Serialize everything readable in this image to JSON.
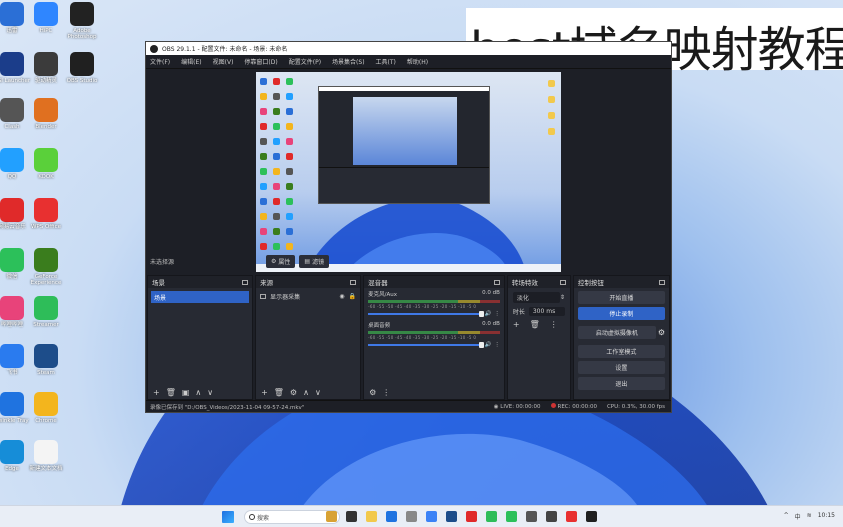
{
  "banner": {
    "text": "host域名映射教程"
  },
  "desktop": {
    "icons": [
      {
        "label": "迅雷",
        "color": "#2b6fd6"
      },
      {
        "label": "HiPC",
        "color": "#2f86ff"
      },
      {
        "label": "Adobe Photoshop",
        "color": "#222"
      },
      {
        "label": "RSI Launcher",
        "color": "#1b3d8a"
      },
      {
        "label": "驱动精灵",
        "color": "#3b3b3b"
      },
      {
        "label": "OBS Studio",
        "color": "#202020"
      },
      {
        "label": "Clash",
        "color": "#555"
      },
      {
        "label": "Blender",
        "color": "#e07020"
      },
      {
        "label": "QQ",
        "color": "#22a0ff"
      },
      {
        "label": "KOOK",
        "color": "#5ad03a"
      },
      {
        "label": "网易云音乐",
        "color": "#e02a2a"
      },
      {
        "label": "WPS Office",
        "color": "#e83030"
      },
      {
        "label": "微信",
        "color": "#2cc05a"
      },
      {
        "label": "GeForce Experience",
        "color": "#3a7d1d"
      },
      {
        "label": "哔哩哔哩",
        "color": "#e8437a"
      },
      {
        "label": "Streamer",
        "color": "#2ebd59"
      },
      {
        "label": "飞书",
        "color": "#2a7bef"
      },
      {
        "label": "Steam",
        "color": "#1d4d8a"
      },
      {
        "label": "Twinkle Tray",
        "color": "#1f73e0"
      },
      {
        "label": "Chrome",
        "color": "#f3b51d"
      },
      {
        "label": "Edge",
        "color": "#168dd8"
      },
      {
        "label": "新建文本文档",
        "color": "#f4f4f4"
      }
    ]
  },
  "obs": {
    "title": "OBS 29.1.1 - 配置文件: 未命名 - 场景: 未命名",
    "menu": [
      "文件(F)",
      "编辑(E)",
      "视图(V)",
      "停靠窗口(D)",
      "配置文件(P)",
      "场景集合(S)",
      "工具(T)",
      "帮助(H)"
    ],
    "scene_bar": {
      "no_source": "未选择源",
      "properties": "属性",
      "filters": "滤镜"
    },
    "docks": {
      "scenes": {
        "title": "场景",
        "items": [
          "场景"
        ]
      },
      "sources": {
        "title": "来源",
        "items": [
          "显示器采集"
        ]
      },
      "mixer": {
        "title": "混音器",
        "channels": [
          {
            "name": "麦克风/Aux",
            "db": "0.0 dB"
          },
          {
            "name": "桌面音频",
            "db": "0.0 dB"
          }
        ],
        "ticks": "-60 -55 -50 -45 -40 -35 -30 -25 -20 -15 -10 -5 0"
      },
      "transitions": {
        "title": "转场特效",
        "type": "淡化",
        "duration_label": "时长",
        "duration": "300 ms"
      },
      "controls": {
        "title": "控制按钮",
        "buttons": [
          "开始直播",
          "停止录制",
          "启动虚拟摄像机",
          "工作室模式",
          "设置",
          "退出"
        ]
      }
    },
    "status": {
      "left": "录像已保存到 \"D:/OBS_Videos/2023-11-04 09-57-24.mkv\"",
      "live": "LIVE: 00:00:00",
      "rec": "REC: 00:00:00",
      "cpu": "CPU: 0.3%, 30.00 fps"
    }
  },
  "taskbar": {
    "search_placeholder": "搜索",
    "tray_lang": "中",
    "tray_time": "10:15"
  }
}
